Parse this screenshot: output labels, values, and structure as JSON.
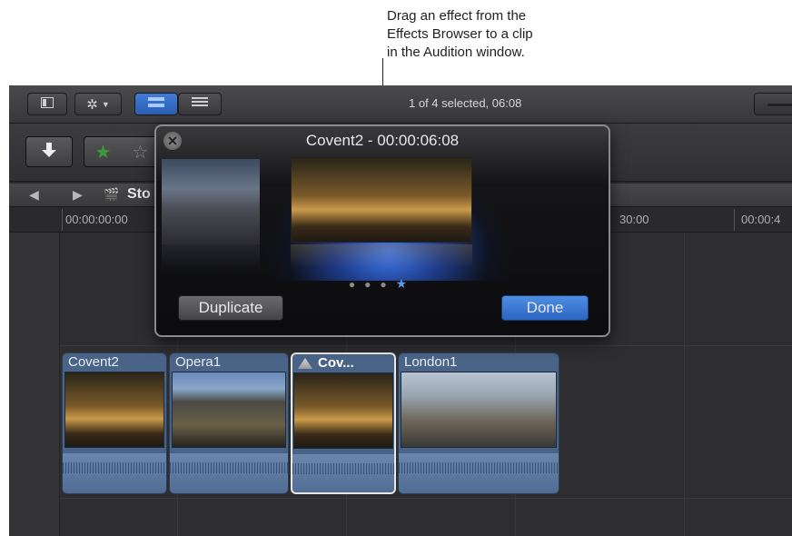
{
  "callout": {
    "line1": "Drag an effect from the",
    "line2": "Effects Browser to a clip",
    "line3": "in the Audition window."
  },
  "toolbar": {
    "status": "1 of 4 selected, 06:08"
  },
  "nav": {
    "project_title": "Sto"
  },
  "ruler": {
    "labels": [
      "00:00:00:00",
      "30:00",
      "00:00:4"
    ]
  },
  "clips": [
    {
      "title": "Covent2"
    },
    {
      "title": "Opera1"
    },
    {
      "title": "Cov..."
    },
    {
      "title": "London1"
    }
  ],
  "audition": {
    "title": "Covent2 - 00:00:06:08",
    "duplicate_label": "Duplicate",
    "done_label": "Done",
    "pick_count": 4,
    "active_pick": 4
  },
  "colors": {
    "accent_blue": "#3f7bd6",
    "clip_blue": "#4a6488",
    "rating_green": "#3d9a3d"
  }
}
